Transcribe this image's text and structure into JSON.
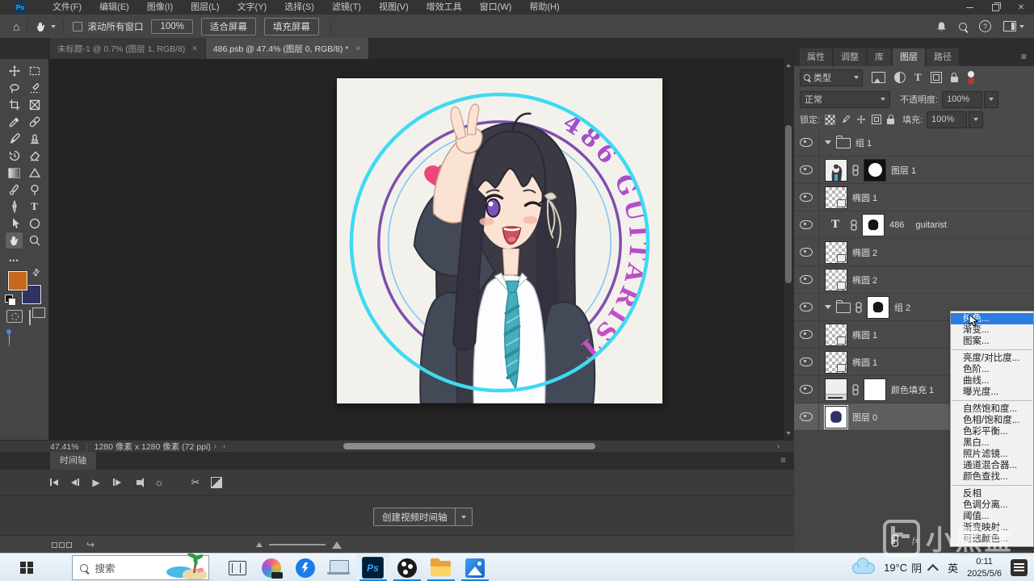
{
  "brand": "Ps",
  "icons": {
    "close": "✕",
    "menu": "≡",
    "home": "⌂",
    "help": "?",
    "play": "▶",
    "scissors": "✂",
    "gear": "☼",
    "export": "↪",
    "chev_r": "›",
    "chev_l": "‹",
    "type": "T",
    "ellipsis": "•••",
    "swap": "⇄",
    "fx": "fx"
  },
  "menubar": {
    "items": [
      "文件(F)",
      "编辑(E)",
      "图像(I)",
      "图层(L)",
      "文字(Y)",
      "选择(S)",
      "滤镜(T)",
      "视图(V)",
      "增效工具",
      "窗口(W)",
      "帮助(H)"
    ]
  },
  "optionsbar": {
    "scroll_all": "滚动所有窗口",
    "zoom": "100%",
    "fit": "适合屏幕",
    "fill": "填充屏幕"
  },
  "doc_tabs": [
    {
      "title": "未标题-1 @ 0.7% (图层 1, RGB/8)"
    },
    {
      "title": "486.psb @ 47.4% (图层 0, RGB/8) *"
    }
  ],
  "canvas": {
    "ring_text": "486   GUITARIST"
  },
  "statusbar": {
    "zoom": "47.41%",
    "info": "1280 像素 x 1280 像素 (72 ppi)"
  },
  "timeline": {
    "tab": "时间轴",
    "create": "创建视频时间轴"
  },
  "panels": {
    "tabs": [
      "属性",
      "调整",
      "库",
      "图层",
      "路径"
    ],
    "search_type": "类型",
    "blend_mode": "正常",
    "opacity_label": "不透明度:",
    "opacity": "100%",
    "lock_label": "锁定:",
    "fill_label": "填充:",
    "fill": "100%"
  },
  "layers": {
    "rows": [
      {
        "name": "组 1"
      },
      {
        "name": "图层 1"
      },
      {
        "name": "椭圆 1"
      },
      {
        "name": "486",
        "name2": "guitarist"
      },
      {
        "name": "椭圆 2"
      },
      {
        "name": "椭圆 2"
      },
      {
        "name": "组 2"
      },
      {
        "name": "椭圆 1"
      },
      {
        "name": "椭圆 1"
      },
      {
        "name": "颜色填充 1"
      },
      {
        "name": "图层 0"
      }
    ]
  },
  "adjust_menu": {
    "groups": [
      [
        "纯色...",
        "渐变...",
        "图案..."
      ],
      [
        "亮度/对比度...",
        "色阶...",
        "曲线...",
        "曝光度..."
      ],
      [
        "自然饱和度...",
        "色相/饱和度...",
        "色彩平衡...",
        "黑白...",
        "照片滤镜...",
        "通道混合器...",
        "颜色查找..."
      ],
      [
        "反相",
        "色调分离...",
        "阈值...",
        "渐变映射...",
        "可选颜色..."
      ]
    ],
    "selected": "纯色..."
  },
  "taskbar": {
    "search": "搜索",
    "temp": "19°C",
    "cond": "阴",
    "lang": "英",
    "time": "0:11",
    "date": "2025/5/6"
  },
  "watermark": {
    "text": "小黑盒"
  },
  "colors": {
    "accent_blue": "#2b7de0",
    "cyan_ring": "#3edaf2",
    "purple_ring": "#7e4fae",
    "ring_text_purple": "#b44fd0",
    "heart_pink": "#f0467e",
    "foreground_swatch": "#c9671d",
    "background_swatch": "#2e3362",
    "taskbar_indicator": "#1883d7"
  }
}
